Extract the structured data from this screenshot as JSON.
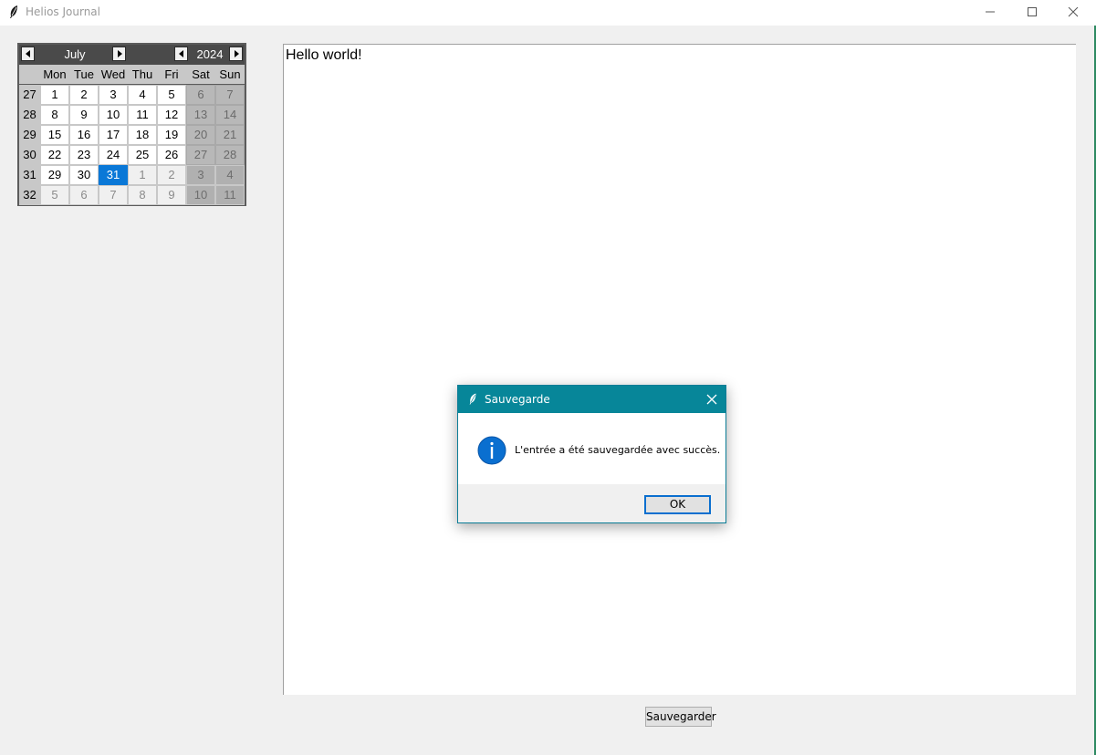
{
  "window": {
    "title": "Helios Journal",
    "icon": "feather-icon"
  },
  "calendar": {
    "month": "July",
    "year": "2024",
    "weekdays": [
      "Mon",
      "Tue",
      "Wed",
      "Thu",
      "Fri",
      "Sat",
      "Sun"
    ],
    "weeks": [
      {
        "number": "27",
        "days": [
          "1",
          "2",
          "3",
          "4",
          "5",
          "6",
          "7"
        ],
        "other": [
          false,
          false,
          false,
          false,
          false,
          false,
          false
        ]
      },
      {
        "number": "28",
        "days": [
          "8",
          "9",
          "10",
          "11",
          "12",
          "13",
          "14"
        ],
        "other": [
          false,
          false,
          false,
          false,
          false,
          false,
          false
        ]
      },
      {
        "number": "29",
        "days": [
          "15",
          "16",
          "17",
          "18",
          "19",
          "20",
          "21"
        ],
        "other": [
          false,
          false,
          false,
          false,
          false,
          false,
          false
        ]
      },
      {
        "number": "30",
        "days": [
          "22",
          "23",
          "24",
          "25",
          "26",
          "27",
          "28"
        ],
        "other": [
          false,
          false,
          false,
          false,
          false,
          false,
          false
        ]
      },
      {
        "number": "31",
        "days": [
          "29",
          "30",
          "31",
          "1",
          "2",
          "3",
          "4"
        ],
        "other": [
          false,
          false,
          false,
          true,
          true,
          true,
          true
        ]
      },
      {
        "number": "32",
        "days": [
          "5",
          "6",
          "7",
          "8",
          "9",
          "10",
          "11"
        ],
        "other": [
          true,
          true,
          true,
          true,
          true,
          true,
          true
        ]
      }
    ],
    "selected_day": "31",
    "selected_color": "#0a78d7"
  },
  "editor": {
    "content": "Hello world!"
  },
  "toolbar": {
    "save_label": "Sauvegarder"
  },
  "dialog": {
    "title": "Sauvegarde",
    "message": "L'entrée a été sauvegardée avec succès.",
    "ok_label": "OK",
    "icon": "info-icon",
    "accent": "#078699"
  }
}
